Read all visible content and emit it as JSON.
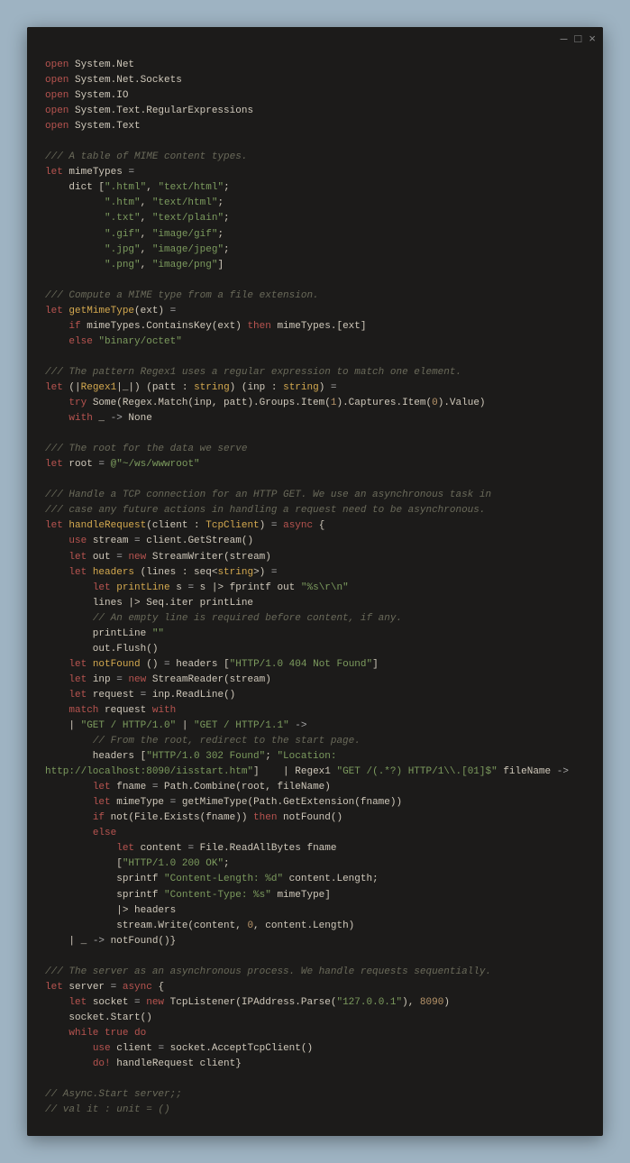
{
  "window": {
    "minimize": "—",
    "maximize": "□",
    "close": "×"
  },
  "code": {
    "lines": [
      [
        [
          "kw",
          "open"
        ],
        [
          "ns",
          " System.Net"
        ]
      ],
      [
        [
          "kw",
          "open"
        ],
        [
          "ns",
          " System.Net.Sockets"
        ]
      ],
      [
        [
          "kw",
          "open"
        ],
        [
          "ns",
          " System.IO"
        ]
      ],
      [
        [
          "kw",
          "open"
        ],
        [
          "ns",
          " System.Text.RegularExpressions"
        ]
      ],
      [
        [
          "kw",
          "open"
        ],
        [
          "ns",
          " System.Text"
        ]
      ],
      [],
      [
        [
          "cm",
          "/// A table of MIME content types."
        ]
      ],
      [
        [
          "kw",
          "let"
        ],
        [
          "ns",
          " mimeTypes "
        ],
        [
          "op",
          "="
        ]
      ],
      [
        [
          "ns",
          "    dict ["
        ],
        [
          "st",
          "\".html\""
        ],
        [
          "ns",
          ", "
        ],
        [
          "st",
          "\"text/html\""
        ],
        [
          "ns",
          ";"
        ]
      ],
      [
        [
          "ns",
          "          "
        ],
        [
          "st",
          "\".htm\""
        ],
        [
          "ns",
          ", "
        ],
        [
          "st",
          "\"text/html\""
        ],
        [
          "ns",
          ";"
        ]
      ],
      [
        [
          "ns",
          "          "
        ],
        [
          "st",
          "\".txt\""
        ],
        [
          "ns",
          ", "
        ],
        [
          "st",
          "\"text/plain\""
        ],
        [
          "ns",
          ";"
        ]
      ],
      [
        [
          "ns",
          "          "
        ],
        [
          "st",
          "\".gif\""
        ],
        [
          "ns",
          ", "
        ],
        [
          "st",
          "\"image/gif\""
        ],
        [
          "ns",
          ";"
        ]
      ],
      [
        [
          "ns",
          "          "
        ],
        [
          "st",
          "\".jpg\""
        ],
        [
          "ns",
          ", "
        ],
        [
          "st",
          "\"image/jpeg\""
        ],
        [
          "ns",
          ";"
        ]
      ],
      [
        [
          "ns",
          "          "
        ],
        [
          "st",
          "\".png\""
        ],
        [
          "ns",
          ", "
        ],
        [
          "st",
          "\"image/png\""
        ],
        [
          "ns",
          "]"
        ]
      ],
      [],
      [
        [
          "cm",
          "/// Compute a MIME type from a file extension."
        ]
      ],
      [
        [
          "kw",
          "let"
        ],
        [
          "fn",
          " getMimeType"
        ],
        [
          "ns",
          "(ext) "
        ],
        [
          "op",
          "="
        ]
      ],
      [
        [
          "ns",
          "    "
        ],
        [
          "kw",
          "if"
        ],
        [
          "ns",
          " mimeTypes.ContainsKey(ext) "
        ],
        [
          "kw",
          "then"
        ],
        [
          "ns",
          " mimeTypes.[ext]"
        ]
      ],
      [
        [
          "ns",
          "    "
        ],
        [
          "kw",
          "else"
        ],
        [
          "ns",
          " "
        ],
        [
          "st",
          "\"binary/octet\""
        ]
      ],
      [],
      [
        [
          "cm",
          "/// The pattern Regex1 uses a regular expression to match one element."
        ]
      ],
      [
        [
          "kw",
          "let"
        ],
        [
          "ns",
          " (|"
        ],
        [
          "fn",
          "Regex1"
        ],
        [
          "ns",
          "|_|) (patt : "
        ],
        [
          "ty",
          "string"
        ],
        [
          "ns",
          ") (inp : "
        ],
        [
          "ty",
          "string"
        ],
        [
          "ns",
          ") "
        ],
        [
          "op",
          "="
        ]
      ],
      [
        [
          "ns",
          "    "
        ],
        [
          "kw",
          "try"
        ],
        [
          "ns",
          " Some(Regex.Match(inp, patt).Groups.Item("
        ],
        [
          "nm",
          "1"
        ],
        [
          "ns",
          ").Captures.Item("
        ],
        [
          "nm",
          "0"
        ],
        [
          "ns",
          ").Value)"
        ]
      ],
      [
        [
          "ns",
          "    "
        ],
        [
          "kw",
          "with"
        ],
        [
          "ns",
          " _ "
        ],
        [
          "op",
          "->"
        ],
        [
          "ns",
          " None"
        ]
      ],
      [],
      [
        [
          "cm",
          "/// The root for the data we serve"
        ]
      ],
      [
        [
          "kw",
          "let"
        ],
        [
          "ns",
          " root "
        ],
        [
          "op",
          "="
        ],
        [
          "ns",
          " "
        ],
        [
          "st",
          "@\"~/ws/wwwroot\""
        ]
      ],
      [],
      [
        [
          "cm",
          "/// Handle a TCP connection for an HTTP GET. We use an asynchronous task in"
        ]
      ],
      [
        [
          "cm",
          "/// case any future actions in handling a request need to be asynchronous."
        ]
      ],
      [
        [
          "kw",
          "let"
        ],
        [
          "fn",
          " handleRequest"
        ],
        [
          "ns",
          "(client : "
        ],
        [
          "ty",
          "TcpClient"
        ],
        [
          "ns",
          ") "
        ],
        [
          "op",
          "="
        ],
        [
          "ns",
          " "
        ],
        [
          "kw",
          "async"
        ],
        [
          "ns",
          " {"
        ]
      ],
      [
        [
          "ns",
          "    "
        ],
        [
          "kw",
          "use"
        ],
        [
          "ns",
          " stream "
        ],
        [
          "op",
          "="
        ],
        [
          "ns",
          " client.GetStream()"
        ]
      ],
      [
        [
          "ns",
          "    "
        ],
        [
          "kw",
          "let"
        ],
        [
          "ns",
          " out "
        ],
        [
          "op",
          "= "
        ],
        [
          "kw",
          "new"
        ],
        [
          "ns",
          " StreamWriter(stream)"
        ]
      ],
      [
        [
          "ns",
          "    "
        ],
        [
          "kw",
          "let"
        ],
        [
          "fn",
          " headers"
        ],
        [
          "ns",
          " (lines : seq<"
        ],
        [
          "ty",
          "string"
        ],
        [
          "ns",
          ">) "
        ],
        [
          "op",
          "="
        ]
      ],
      [
        [
          "ns",
          "        "
        ],
        [
          "kw",
          "let"
        ],
        [
          "fn",
          " printLine"
        ],
        [
          "ns",
          " s "
        ],
        [
          "op",
          "="
        ],
        [
          "ns",
          " s |> fprintf out "
        ],
        [
          "st",
          "\"%s\\r\\n\""
        ]
      ],
      [
        [
          "ns",
          "        lines |> Seq.iter printLine"
        ]
      ],
      [
        [
          "ns",
          "        "
        ],
        [
          "cm",
          "// An empty line is required before content, if any."
        ]
      ],
      [
        [
          "ns",
          "        printLine "
        ],
        [
          "st",
          "\"\""
        ]
      ],
      [
        [
          "ns",
          "        out.Flush()"
        ]
      ],
      [
        [
          "ns",
          "    "
        ],
        [
          "kw",
          "let"
        ],
        [
          "fn",
          " notFound"
        ],
        [
          "ns",
          " () "
        ],
        [
          "op",
          "="
        ],
        [
          "ns",
          " headers ["
        ],
        [
          "st",
          "\"HTTP/1.0 404 Not Found\""
        ],
        [
          "ns",
          "]"
        ]
      ],
      [
        [
          "ns",
          "    "
        ],
        [
          "kw",
          "let"
        ],
        [
          "ns",
          " inp "
        ],
        [
          "op",
          "= "
        ],
        [
          "kw",
          "new"
        ],
        [
          "ns",
          " StreamReader(stream)"
        ]
      ],
      [
        [
          "ns",
          "    "
        ],
        [
          "kw",
          "let"
        ],
        [
          "ns",
          " request "
        ],
        [
          "op",
          "="
        ],
        [
          "ns",
          " inp.ReadLine()"
        ]
      ],
      [
        [
          "ns",
          "    "
        ],
        [
          "kw",
          "match"
        ],
        [
          "ns",
          " request "
        ],
        [
          "kw",
          "with"
        ]
      ],
      [
        [
          "ns",
          "    | "
        ],
        [
          "st",
          "\"GET / HTTP/1.0\""
        ],
        [
          "ns",
          " | "
        ],
        [
          "st",
          "\"GET / HTTP/1.1\""
        ],
        [
          "ns",
          " "
        ],
        [
          "op",
          "->"
        ]
      ],
      [
        [
          "ns",
          "        "
        ],
        [
          "cm",
          "// From the root, redirect to the start page."
        ]
      ],
      [
        [
          "ns",
          "        headers ["
        ],
        [
          "st",
          "\"HTTP/1.0 302 Found\""
        ],
        [
          "ns",
          "; "
        ],
        [
          "st",
          "\"Location:"
        ]
      ],
      [
        [
          "st",
          "http://localhost:8090/iisstart.htm\""
        ],
        [
          "ns",
          "]"
        ],
        [
          "ns",
          "    | Regex1 "
        ],
        [
          "st",
          "\"GET /(.*?) HTTP/1\\\\.[01]$\""
        ],
        [
          "ns",
          " fileName "
        ],
        [
          "op",
          "->"
        ]
      ],
      [
        [
          "ns",
          "        "
        ],
        [
          "kw",
          "let"
        ],
        [
          "ns",
          " fname "
        ],
        [
          "op",
          "="
        ],
        [
          "ns",
          " Path.Combine(root, fileName)"
        ]
      ],
      [
        [
          "ns",
          "        "
        ],
        [
          "kw",
          "let"
        ],
        [
          "ns",
          " mimeType "
        ],
        [
          "op",
          "="
        ],
        [
          "ns",
          " getMimeType(Path.GetExtension(fname))"
        ]
      ],
      [
        [
          "ns",
          "        "
        ],
        [
          "kw",
          "if"
        ],
        [
          "ns",
          " not(File.Exists(fname)) "
        ],
        [
          "kw",
          "then"
        ],
        [
          "ns",
          " notFound()"
        ]
      ],
      [
        [
          "ns",
          "        "
        ],
        [
          "kw",
          "else"
        ]
      ],
      [
        [
          "ns",
          "            "
        ],
        [
          "kw",
          "let"
        ],
        [
          "ns",
          " content "
        ],
        [
          "op",
          "="
        ],
        [
          "ns",
          " File.ReadAllBytes fname"
        ]
      ],
      [
        [
          "ns",
          "            ["
        ],
        [
          "st",
          "\"HTTP/1.0 200 OK\""
        ],
        [
          "ns",
          ";"
        ]
      ],
      [
        [
          "ns",
          "            sprintf "
        ],
        [
          "st",
          "\"Content-Length: %d\""
        ],
        [
          "ns",
          " content.Length;"
        ]
      ],
      [
        [
          "ns",
          "            sprintf "
        ],
        [
          "st",
          "\"Content-Type: %s\""
        ],
        [
          "ns",
          " mimeType]"
        ]
      ],
      [
        [
          "ns",
          "            |> headers"
        ]
      ],
      [
        [
          "ns",
          "            stream.Write(content, "
        ],
        [
          "nm",
          "0"
        ],
        [
          "ns",
          ", content.Length)"
        ]
      ],
      [
        [
          "ns",
          "    | _ "
        ],
        [
          "op",
          "->"
        ],
        [
          "ns",
          " notFound()}"
        ]
      ],
      [],
      [
        [
          "cm",
          "/// The server as an asynchronous process. We handle requests sequentially."
        ]
      ],
      [
        [
          "kw",
          "let"
        ],
        [
          "ns",
          " server "
        ],
        [
          "op",
          "="
        ],
        [
          "ns",
          " "
        ],
        [
          "kw",
          "async"
        ],
        [
          "ns",
          " {"
        ]
      ],
      [
        [
          "ns",
          "    "
        ],
        [
          "kw",
          "let"
        ],
        [
          "ns",
          " socket "
        ],
        [
          "op",
          "= "
        ],
        [
          "kw",
          "new"
        ],
        [
          "ns",
          " TcpListener(IPAddress.Parse("
        ],
        [
          "st",
          "\"127.0.0.1\""
        ],
        [
          "ns",
          "), "
        ],
        [
          "nm",
          "8090"
        ],
        [
          "ns",
          ")"
        ]
      ],
      [
        [
          "ns",
          "    socket.Start()"
        ]
      ],
      [
        [
          "ns",
          "    "
        ],
        [
          "kw",
          "while"
        ],
        [
          "ns",
          " "
        ],
        [
          "kw",
          "true"
        ],
        [
          "ns",
          " "
        ],
        [
          "kw",
          "do"
        ]
      ],
      [
        [
          "ns",
          "        "
        ],
        [
          "kw",
          "use"
        ],
        [
          "ns",
          " client "
        ],
        [
          "op",
          "="
        ],
        [
          "ns",
          " socket.AcceptTcpClient()"
        ]
      ],
      [
        [
          "ns",
          "        "
        ],
        [
          "kw",
          "do!"
        ],
        [
          "ns",
          " handleRequest client}"
        ]
      ],
      [],
      [
        [
          "cm",
          "// Async.Start server;;"
        ]
      ],
      [
        [
          "cm",
          "// val it : unit = ()"
        ]
      ]
    ]
  }
}
